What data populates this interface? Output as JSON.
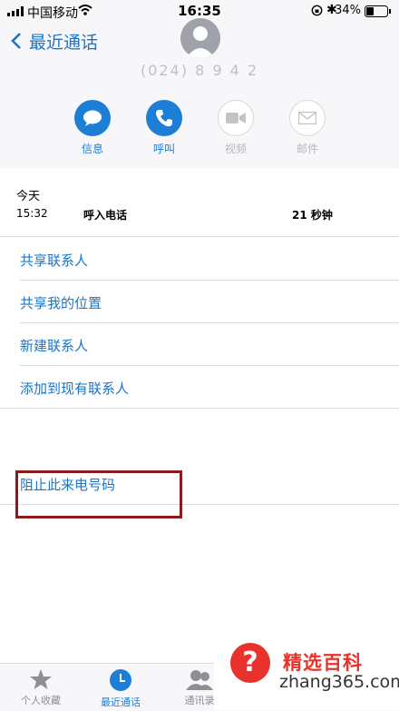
{
  "status_bar": {
    "carrier": "中国移动",
    "time": "16:35",
    "battery": "34%"
  },
  "nav": {
    "back_label": "最近通话"
  },
  "contact": {
    "number": "(024) 8 9 4 2"
  },
  "actions": [
    {
      "label": "信息",
      "icon": "message-icon",
      "enabled": true
    },
    {
      "label": "呼叫",
      "icon": "phone-icon",
      "enabled": true
    },
    {
      "label": "视频",
      "icon": "video-icon",
      "enabled": false
    },
    {
      "label": "邮件",
      "icon": "mail-icon",
      "enabled": false
    }
  ],
  "call_log": {
    "date": "今天",
    "time": "15:32",
    "type": "呼入电话",
    "duration": "21 秒钟"
  },
  "menu": {
    "share_contact": "共享联系人",
    "share_location": "共享我的位置",
    "new_contact": "新建联系人",
    "add_existing": "添加到现有联系人",
    "block_caller": "阻止此来电号码"
  },
  "tabs": [
    {
      "label": "个人收藏",
      "icon": "star-icon",
      "active": false
    },
    {
      "label": "最近通话",
      "icon": "clock-icon",
      "active": true
    },
    {
      "label": "通讯录",
      "icon": "contacts-icon",
      "active": false
    }
  ],
  "watermark": {
    "title": "精选百科",
    "url": "zhang365.com"
  },
  "colors": {
    "accent": "#1d7ed6",
    "highlight_box": "#8b1a1a",
    "watermark_red": "#e8322b"
  }
}
